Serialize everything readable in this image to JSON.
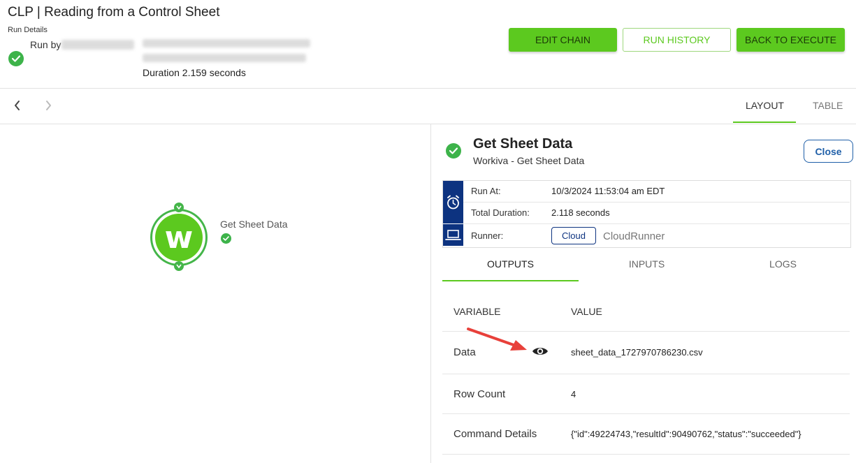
{
  "header": {
    "title": "CLP | Reading from a Control Sheet",
    "run_details_label": "Run Details",
    "run_by_label": "Run by",
    "duration_text": "Duration 2.159 seconds"
  },
  "buttons": {
    "edit_chain": "EDIT CHAIN",
    "run_history": "RUN HISTORY",
    "back_to_execute": "BACK TO EXECUTE"
  },
  "nav": {
    "prev_icon": "chevron-left-icon",
    "next_icon": "chevron-right-icon"
  },
  "view_tabs": {
    "layout": "LAYOUT",
    "table": "TABLE",
    "active": "layout"
  },
  "canvas": {
    "node_label": "Get Sheet Data",
    "node_logo_letter": "w",
    "node_status": "success"
  },
  "panel": {
    "title": "Get Sheet Data",
    "subtitle": "Workiva - Get Sheet Data",
    "close_label": "Close",
    "info": {
      "run_at_label": "Run At:",
      "run_at_value": "10/3/2024 11:53:04 am EDT",
      "total_duration_label": "Total Duration:",
      "total_duration_value": "2.118 seconds",
      "runner_label": "Runner:",
      "runner_badge": "Cloud",
      "runner_name": "CloudRunner"
    },
    "tabs": {
      "outputs": "OUTPUTS",
      "inputs": "INPUTS",
      "logs": "LOGS",
      "active": "outputs"
    },
    "outputs_table": {
      "variable_header": "VARIABLE",
      "value_header": "VALUE",
      "rows": [
        {
          "variable": "Data",
          "value": "sheet_data_1727970786230.csv",
          "icon": "eye-icon"
        },
        {
          "variable": "Row Count",
          "value": "4"
        },
        {
          "variable": "Command Details",
          "value": "{\"id\":49224743,\"resultId\":90490762,\"status\":\"succeeded\"}"
        }
      ]
    }
  },
  "colors": {
    "accent_green": "#5cc91f",
    "status_green": "#3db34a",
    "navy": "#0d3380",
    "close_blue": "#1f5fa8",
    "annotation_red": "#e8403a"
  }
}
